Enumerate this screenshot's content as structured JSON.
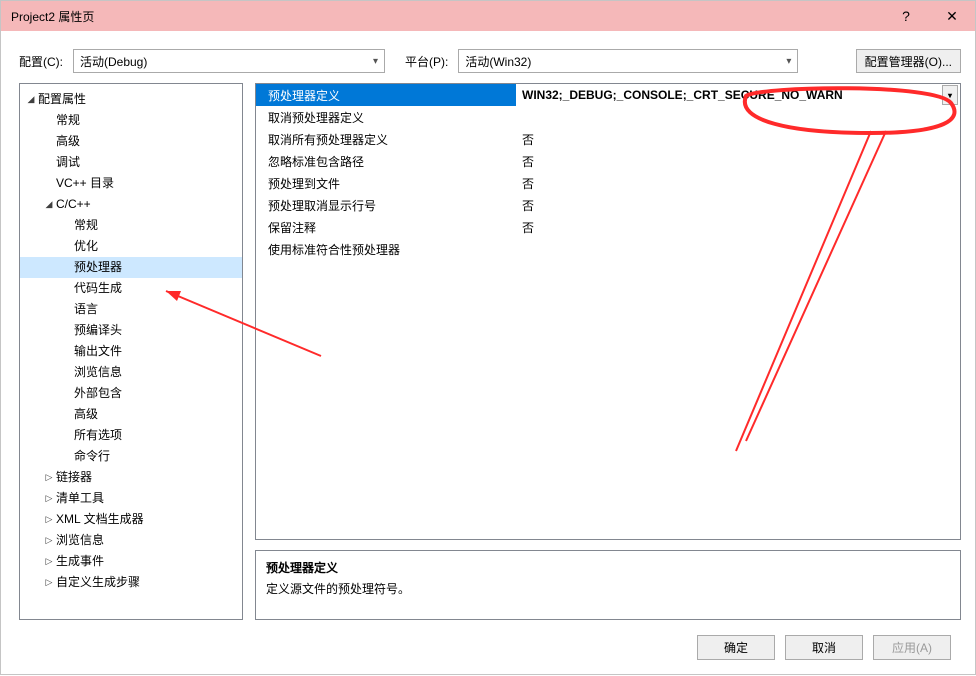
{
  "window": {
    "title": "Project2 属性页"
  },
  "top": {
    "config_label": "配置(C):",
    "config_value": "活动(Debug)",
    "platform_label": "平台(P):",
    "platform_value": "活动(Win32)",
    "mgr_button": "配置管理器(O)..."
  },
  "tree": {
    "root": "配置属性",
    "lvl1": [
      "常规",
      "高级",
      "调试",
      "VC++ 目录"
    ],
    "cpp": "C/C++",
    "cpp_children": [
      "常规",
      "优化",
      "预处理器",
      "代码生成",
      "语言",
      "预编译头",
      "输出文件",
      "浏览信息",
      "外部包含",
      "高级",
      "所有选项",
      "命令行"
    ],
    "after": [
      "链接器",
      "清单工具",
      "XML 文档生成器",
      "浏览信息",
      "生成事件",
      "自定义生成步骤"
    ]
  },
  "grid": {
    "rows": [
      {
        "k": "预处理器定义",
        "v": "WIN32;_DEBUG;_CONSOLE;_CRT_SECURE_NO_WARN"
      },
      {
        "k": "取消预处理器定义",
        "v": ""
      },
      {
        "k": "取消所有预处理器定义",
        "v": "否"
      },
      {
        "k": "忽略标准包含路径",
        "v": "否"
      },
      {
        "k": "预处理到文件",
        "v": "否"
      },
      {
        "k": "预处理取消显示行号",
        "v": "否"
      },
      {
        "k": "保留注释",
        "v": "否"
      },
      {
        "k": "使用标准符合性预处理器",
        "v": ""
      }
    ]
  },
  "desc": {
    "title": "预处理器定义",
    "body": "定义源文件的预处理符号。"
  },
  "footer": {
    "ok": "确定",
    "cancel": "取消",
    "apply": "应用(A)"
  }
}
